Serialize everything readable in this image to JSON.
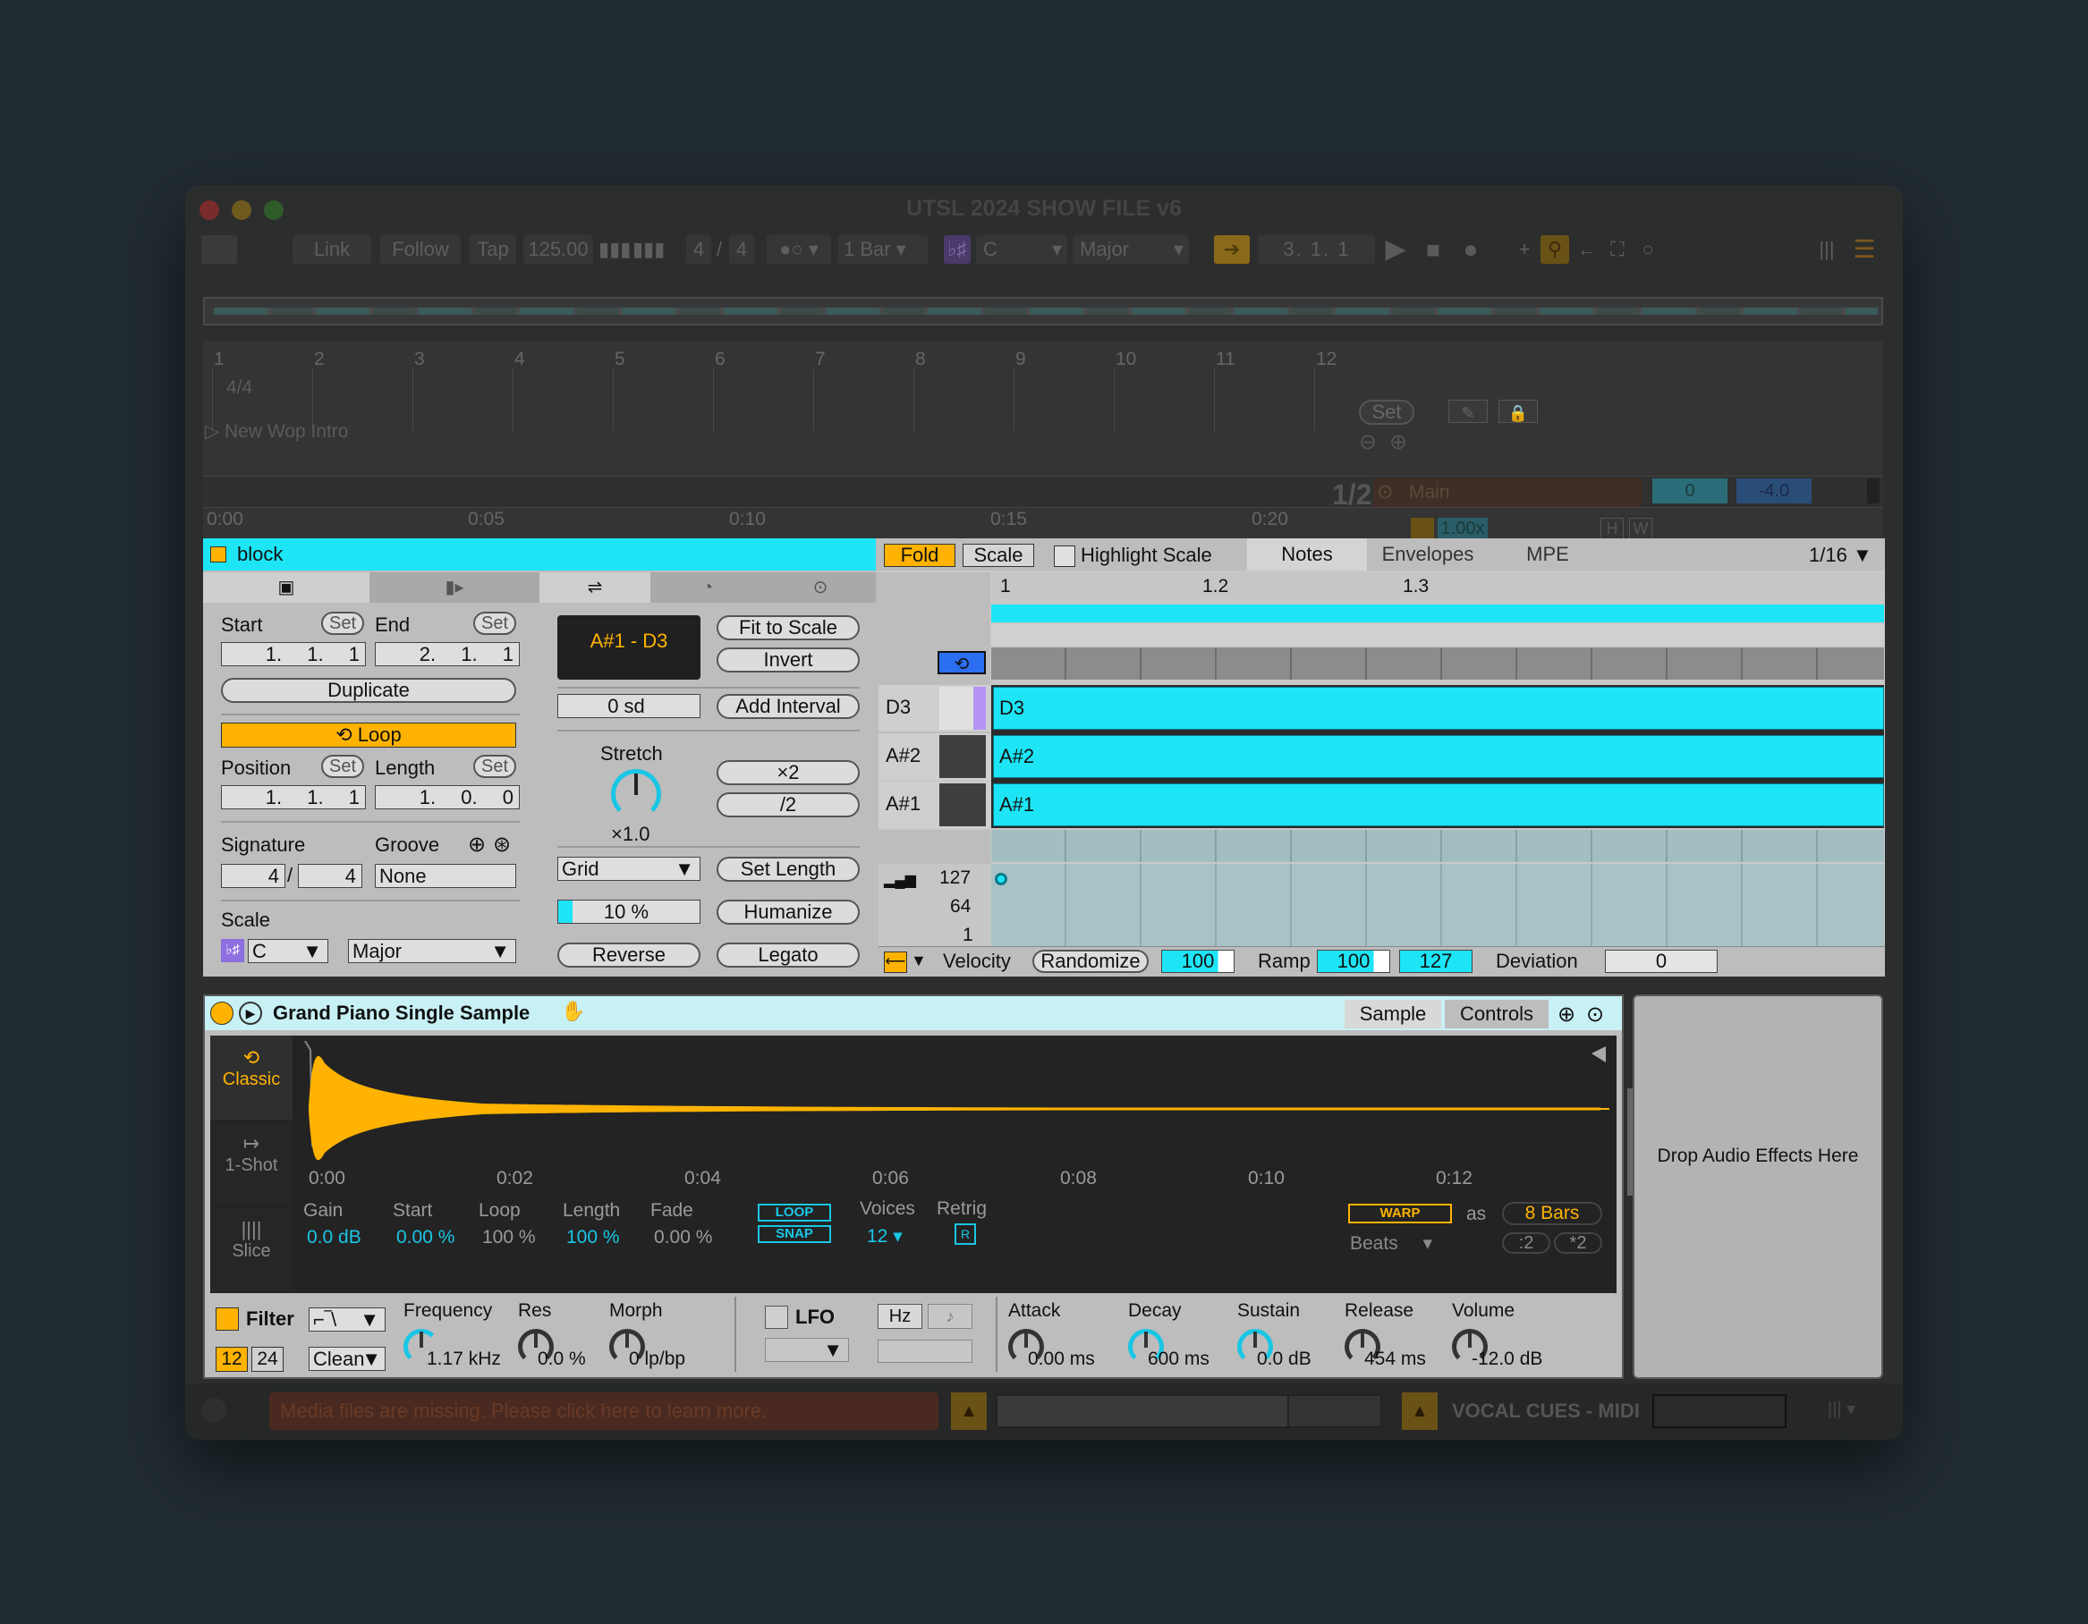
{
  "window": {
    "title": "UTSL 2024 SHOW FILE v6"
  },
  "toolbar": {
    "link": "Link",
    "follow": "Follow",
    "tap": "Tap",
    "tempo": "125.00",
    "sig_num": "4",
    "sig_den": "4",
    "quantize": "1 Bar",
    "key_root": "C",
    "scale": "Major",
    "position": "3.  1.  1"
  },
  "arrangement": {
    "bars": [
      "1",
      "2",
      "3",
      "4",
      "5",
      "6",
      "7",
      "8",
      "9",
      "10",
      "11",
      "12"
    ],
    "meter": "4/4",
    "locator": "New Wop Intro",
    "times": [
      "0:00",
      "0:05",
      "0:10",
      "0:15",
      "0:20"
    ],
    "set_label": "Set",
    "fraction": "1/2",
    "main": "Main",
    "main_vol": "0",
    "main_db": "-4.0",
    "speed": "1.00x",
    "h": "H",
    "w": "W"
  },
  "clip": {
    "name": "block",
    "start_label": "Start",
    "end_label": "End",
    "set": "Set",
    "start_vals": [
      "1.",
      "1.",
      "1"
    ],
    "end_vals": [
      "2.",
      "1.",
      "1"
    ],
    "duplicate": "Duplicate",
    "loop": "Loop",
    "position_label": "Position",
    "length_label": "Length",
    "pos_vals": [
      "1.",
      "1.",
      "1"
    ],
    "len_vals": [
      "1.",
      "0.",
      "0"
    ],
    "signature_label": "Signature",
    "groove_label": "Groove",
    "sig_num": "4",
    "sig_den": "4",
    "groove": "None",
    "scale_label": "Scale",
    "scale_root": "C",
    "scale_mode": "Major"
  },
  "tools": {
    "range": "A#1 - D3",
    "fit_to_scale": "Fit to Scale",
    "invert": "Invert",
    "interval": "0 sd",
    "add_interval": "Add Interval",
    "stretch": "Stretch",
    "stretch_val": "×1.0",
    "x2": "×2",
    "div2": "/2",
    "grid": "Grid",
    "set_length": "Set Length",
    "humanize_amt": "10 %",
    "humanize": "Humanize",
    "reverse": "Reverse",
    "legato": "Legato"
  },
  "notes_editor": {
    "fold": "Fold",
    "scale": "Scale",
    "highlight_scale": "Highlight Scale",
    "tabs": [
      "Notes",
      "Envelopes",
      "MPE"
    ],
    "grid": "1/16",
    "ruler": [
      "1",
      "1.2",
      "1.3"
    ],
    "keys": [
      "D3",
      "A#2",
      "A#1"
    ],
    "vel_scale": [
      "127",
      "64",
      "1"
    ],
    "velocity": "Velocity",
    "randomize": "Randomize",
    "vel_val": "100",
    "ramp": "Ramp",
    "ramp_a": "100",
    "ramp_b": "127",
    "deviation": "Deviation",
    "deviation_val": "0"
  },
  "device": {
    "name": "Grand Piano Single Sample",
    "tabs": [
      "Sample",
      "Controls"
    ],
    "modes": [
      "Classic",
      "1-Shot",
      "Slice"
    ],
    "wave_times": [
      "0:00",
      "0:02",
      "0:04",
      "0:06",
      "0:08",
      "0:10",
      "0:12"
    ],
    "params": [
      {
        "label": "Gain",
        "value": "0.0 dB"
      },
      {
        "label": "Start",
        "value": "0.00 %"
      },
      {
        "label": "Loop",
        "value": "100 %"
      },
      {
        "label": "Length",
        "value": "100 %"
      },
      {
        "label": "Fade",
        "value": "0.00 %"
      }
    ],
    "loop_btn": "LOOP",
    "snap_btn": "SNAP",
    "voices_label": "Voices",
    "voices_val": "12",
    "retrig_label": "Retrig",
    "retrig_btn": "R",
    "warp": "WARP",
    "as": "as",
    "bars": "8 Bars",
    "beats": "Beats",
    "half": ":2",
    "double": "*2",
    "filter": "Filter",
    "slope12": "12",
    "slope24": "24",
    "circuit": "Clean",
    "frequency_label": "Frequency",
    "frequency": "1.17 kHz",
    "res_label": "Res",
    "res": "0.0 %",
    "morph_label": "Morph",
    "morph": "0 lp/bp",
    "lfo": "LFO",
    "hz": "Hz",
    "env": [
      {
        "label": "Attack",
        "value": "0.00 ms"
      },
      {
        "label": "Decay",
        "value": "600 ms"
      },
      {
        "label": "Sustain",
        "value": "0.0 dB"
      },
      {
        "label": "Release",
        "value": "454 ms"
      },
      {
        "label": "Volume",
        "value": "-12.0 dB"
      }
    ]
  },
  "drop_zone": "Drop Audio Effects Here",
  "status": {
    "message": "Media files are missing. Please click here to learn more.",
    "track": "VOCAL CUES - MIDI"
  },
  "colors": {
    "accent_cyan": "#1de5f6",
    "accent_amber": "#ffb300",
    "background": "#212c32"
  }
}
